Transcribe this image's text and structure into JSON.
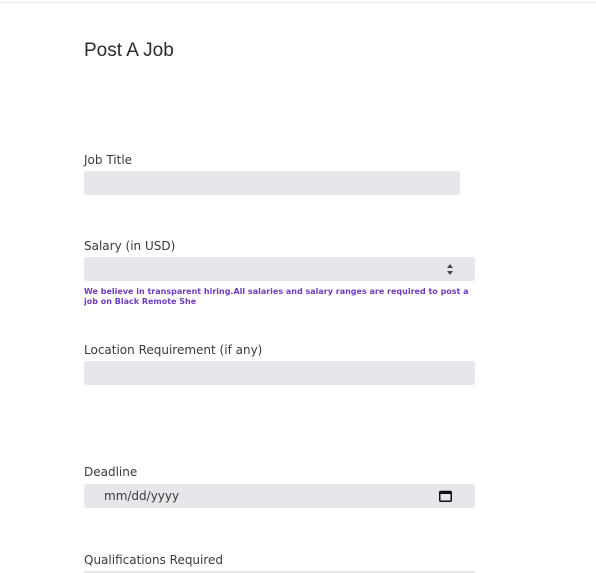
{
  "form": {
    "title": "Post A Job",
    "job_title": {
      "label": "Job Title",
      "value": ""
    },
    "salary": {
      "label": "Salary (in USD)",
      "value": "",
      "note": "We believe in transparent hiring.All salaries and salary ranges are required to post a job on Black Remote She"
    },
    "location": {
      "label": "Location Requirement (if any)",
      "value": ""
    },
    "deadline": {
      "label": "Deadline",
      "placeholder": "mm/dd/yyyy"
    },
    "qualifications": {
      "label": "Qualifications Required",
      "value": ""
    }
  },
  "icons": {
    "spinner": "number-spinner-icon",
    "calendar": "calendar-icon"
  },
  "colors": {
    "input_bg": "#e6e7ea",
    "note_text": "#6f3cbc",
    "label_text": "#3a3a3a"
  }
}
